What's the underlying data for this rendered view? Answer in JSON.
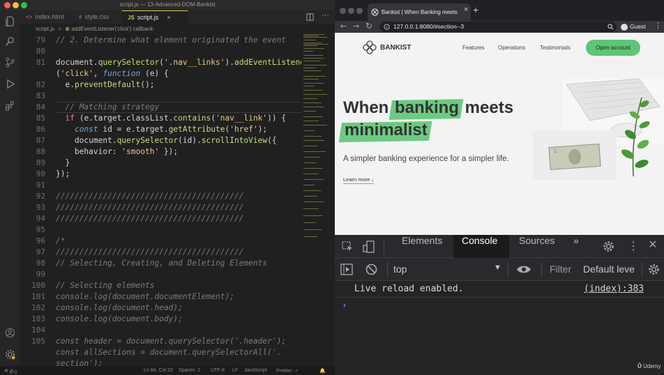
{
  "editor": {
    "window_title": "script.js — 13-Advanced-DOM-Bankist",
    "tabs": [
      {
        "label": "index.html",
        "icon": "<>"
      },
      {
        "label": "style.css",
        "icon": "#"
      },
      {
        "label": "script.js",
        "icon": "JS",
        "active": true
      }
    ],
    "breadcrumb": {
      "file": "script.js",
      "sep": ">",
      "symbol": "addEventListener('click') callback"
    },
    "line_numbers": [
      "79",
      "80",
      "81",
      "",
      "82",
      "83",
      "84",
      "85",
      "86",
      "87",
      "88",
      "89",
      "90",
      "91",
      "92",
      "93",
      "94",
      "95",
      "96",
      "97",
      "98",
      "99",
      "100",
      "101",
      "102",
      "103",
      "104",
      "105",
      ""
    ],
    "status": {
      "errors": "0",
      "warnings": "0",
      "position": "Ln 84, Col 23",
      "spaces": "Spaces: 2",
      "encoding": "UTF-8",
      "eol": "LF",
      "language": "JavaScript",
      "formatter": "Prettier: ✓"
    }
  },
  "browser": {
    "tab_title": "Bankist | When Banking meets",
    "url": "127.0.0.1:8080/#section--3",
    "profile": "Guest",
    "page": {
      "logo": "BANKIST",
      "nav": [
        "Features",
        "Operations",
        "Testimonials"
      ],
      "cta": "Open account",
      "headline_1a": "When ",
      "headline_1b": "banking",
      "headline_1c": " meets",
      "headline_2": "minimalist",
      "subtitle": "A simpler banking experience for a simpler life.",
      "learn_more": "Learn more ↓"
    },
    "devtools": {
      "tabs": [
        "Elements",
        "Console",
        "Sources",
        "»"
      ],
      "active_tab": "Console",
      "context": "top",
      "filter_placeholder": "Filter",
      "levels": "Default leve",
      "log_message": "Live reload enabled.",
      "log_source": "(index):383",
      "prompt": "›"
    }
  },
  "overlay": {
    "watermark": "Udemy"
  },
  "colors": {
    "accent": "#5ec576",
    "editor_bg": "#202020",
    "tab_active_border": "#e0c94a"
  }
}
